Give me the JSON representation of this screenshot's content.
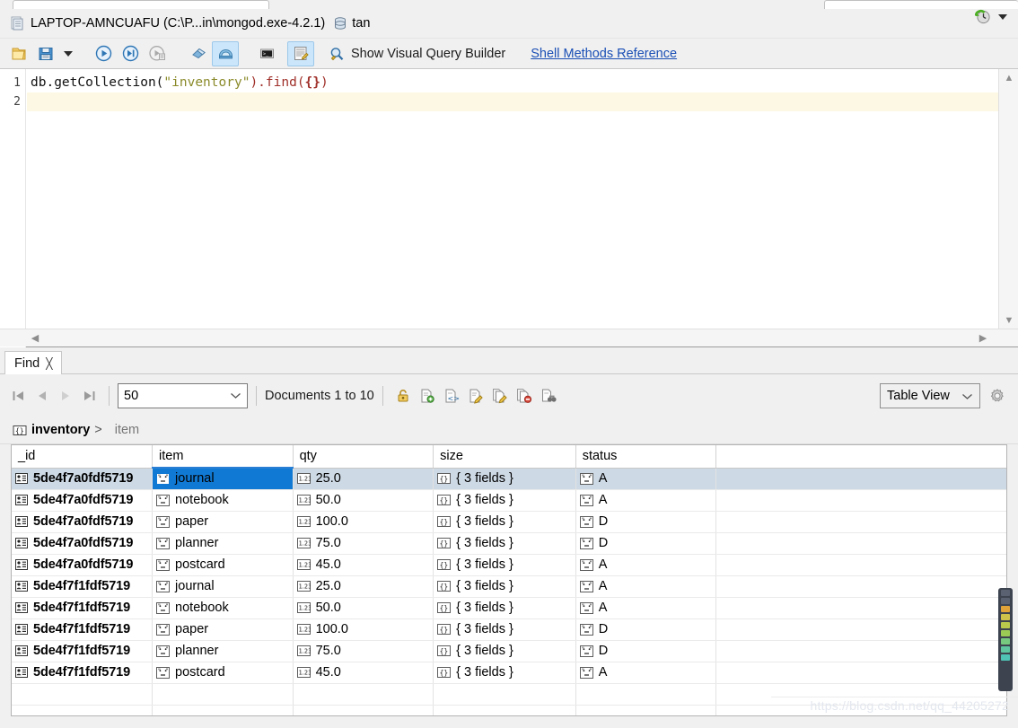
{
  "window": {
    "title": "LAPTOP-AMNCUAFU (C:\\P...in\\mongod.exe-4.2.1)",
    "db_name": "tan",
    "doc_icon": "document-icon",
    "db_icon": "database-icon",
    "history_icon": "history-clock-icon",
    "history_caret_icon": "chevron-down-icon"
  },
  "toolbar": {
    "buttons": [
      {
        "name": "open-script-button",
        "icon": "folder-icon",
        "active": false
      },
      {
        "name": "save-script-button",
        "icon": "save-floppy-icon",
        "active": false
      },
      {
        "name": "save-dropdown-button",
        "icon": "chevron-down-icon",
        "active": false
      },
      {
        "name": "execute-button",
        "icon": "play-circle-icon",
        "active": false
      },
      {
        "name": "execute-all-button",
        "icon": "play-to-end-icon",
        "active": false
      },
      {
        "name": "execute-script-button",
        "icon": "play-script-icon",
        "active": false
      },
      {
        "name": "stop-button",
        "icon": "eraser-icon",
        "active": false
      },
      {
        "name": "stop-all-button",
        "icon": "stop-all-icon",
        "active": true
      },
      {
        "name": "console-button",
        "icon": "terminal-icon",
        "active": false
      },
      {
        "name": "edit-document-button",
        "icon": "edit-list-icon",
        "active": true
      }
    ],
    "visual_query_builder_icon": "magnifier-builder-icon",
    "visual_query_builder_label": "Show Visual Query Builder",
    "shell_methods_link": "Shell Methods Reference"
  },
  "editor": {
    "line_numbers": [
      "1",
      "2"
    ],
    "current_line": 2,
    "code_line_1": {
      "prefix": "db.getCollection(",
      "string": "\"inventory\"",
      "mid": ").find(",
      "braces": "{}",
      "suffix": ")"
    },
    "code_line_2": "",
    "scroll_up_icon": "chevron-up-icon",
    "scroll_down_icon": "chevron-down-icon",
    "scroll_left_icon": "chevron-left-icon",
    "scroll_right_icon": "chevron-right-icon"
  },
  "find_panel": {
    "tab_label": "Find",
    "close_icon": "close-icon",
    "nav": [
      {
        "name": "first-page-button",
        "icon": "first-page-icon"
      },
      {
        "name": "prev-page-button",
        "icon": "prev-page-icon"
      },
      {
        "name": "next-page-button",
        "icon": "next-page-icon"
      },
      {
        "name": "last-page-button",
        "icon": "last-page-icon"
      }
    ],
    "limit_value": "50",
    "limit_caret_icon": "chevron-down-icon",
    "documents_label": "Documents 1 to 10",
    "doc_actions": [
      {
        "name": "lock-document-button",
        "icon": "padlock-icon"
      },
      {
        "name": "insert-document-button",
        "icon": "document-add-icon"
      },
      {
        "name": "view-json-button",
        "icon": "document-code-icon"
      },
      {
        "name": "edit-document-button",
        "icon": "document-edit-icon"
      },
      {
        "name": "clone-document-button",
        "icon": "documents-edit-icon"
      },
      {
        "name": "delete-document-button",
        "icon": "document-delete-icon"
      },
      {
        "name": "find-document-button",
        "icon": "document-binoculars-icon"
      }
    ],
    "view_mode": "Table View",
    "view_caret_icon": "chevron-down-icon",
    "settings_icon": "gear-icon"
  },
  "breadcrumb": {
    "collection_icon": "braces-icon",
    "collection": "inventory",
    "separator": ">",
    "field": "item"
  },
  "table": {
    "columns": [
      "_id",
      "item",
      "qty",
      "size",
      "status"
    ],
    "selected_column": "item",
    "selected_row_index": 0,
    "selected_cell": "item",
    "rows": [
      {
        "_id": "5de4f7a0fdf5719",
        "item": "journal",
        "qty": "25.0",
        "size": "{ 3 fields }",
        "status": "A"
      },
      {
        "_id": "5de4f7a0fdf5719",
        "item": "notebook",
        "qty": "50.0",
        "size": "{ 3 fields }",
        "status": "A"
      },
      {
        "_id": "5de4f7a0fdf5719",
        "item": "paper",
        "qty": "100.0",
        "size": "{ 3 fields }",
        "status": "D"
      },
      {
        "_id": "5de4f7a0fdf5719",
        "item": "planner",
        "qty": "75.0",
        "size": "{ 3 fields }",
        "status": "D"
      },
      {
        "_id": "5de4f7a0fdf5719",
        "item": "postcard",
        "qty": "45.0",
        "size": "{ 3 fields }",
        "status": "A"
      },
      {
        "_id": "5de4f7f1fdf5719",
        "item": "journal",
        "qty": "25.0",
        "size": "{ 3 fields }",
        "status": "A"
      },
      {
        "_id": "5de4f7f1fdf5719",
        "item": "notebook",
        "qty": "50.0",
        "size": "{ 3 fields }",
        "status": "A"
      },
      {
        "_id": "5de4f7f1fdf5719",
        "item": "paper",
        "qty": "100.0",
        "size": "{ 3 fields }",
        "status": "D"
      },
      {
        "_id": "5de4f7f1fdf5719",
        "item": "planner",
        "qty": "75.0",
        "size": "{ 3 fields }",
        "status": "D"
      },
      {
        "_id": "5de4f7f1fdf5719",
        "item": "postcard",
        "qty": "45.0",
        "size": "{ 3 fields }",
        "status": "A"
      }
    ],
    "type_icons": {
      "_id": "objectid-icon",
      "item": "string-icon",
      "qty": "number-icon",
      "size": "object-icon",
      "status": "string-icon"
    }
  },
  "watermark": "https://blog.csdn.net/qq_44205272",
  "colors": {
    "accent": "#1079d4",
    "selected_row": "#cdd9e5",
    "toolbar_active": "#cbe6fb",
    "link": "#1a4fb5",
    "current_line": "#fdf8e3"
  }
}
